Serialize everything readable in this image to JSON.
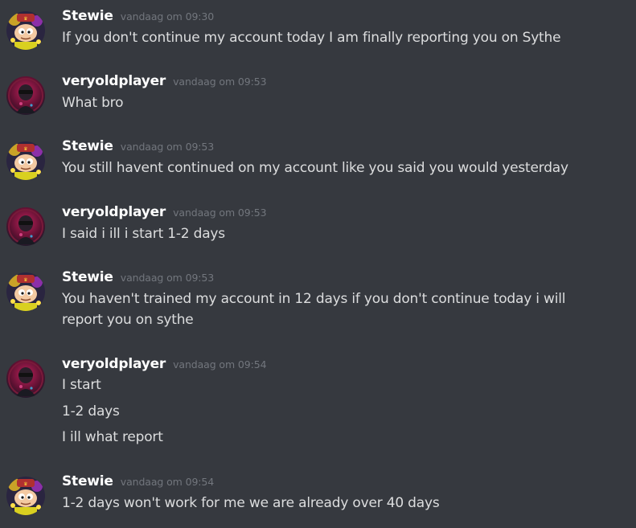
{
  "users": {
    "stewie": {
      "name": "Stewie",
      "avatar_icon": "stewie-avatar-icon"
    },
    "veryoldplayer": {
      "name": "veryoldplayer",
      "avatar_icon": "player-avatar-icon"
    }
  },
  "messages": [
    {
      "author": "Stewie",
      "time": "vandaag om 09:30",
      "lines": [
        "If you don't continue my account today I am finally reporting you on Sythe"
      ]
    },
    {
      "author": "veryoldplayer",
      "time": "vandaag om 09:53",
      "lines": [
        "What bro"
      ]
    },
    {
      "author": "Stewie",
      "time": "vandaag om 09:53",
      "lines": [
        "You still havent continued on my account like you said you would yesterday"
      ]
    },
    {
      "author": "veryoldplayer",
      "time": "vandaag om 09:53",
      "lines": [
        "I said i ill i start 1-2 days"
      ]
    },
    {
      "author": "Stewie",
      "time": "vandaag om 09:53",
      "lines": [
        "You haven't trained my account in 12 days if you don't continue today i will",
        "report you on sythe"
      ]
    },
    {
      "author": "veryoldplayer",
      "time": "vandaag om 09:54",
      "lines": [
        "I start",
        "1-2 days",
        "I ill what report"
      ]
    },
    {
      "author": "Stewie",
      "time": "vandaag om 09:54",
      "lines": [
        "1-2 days won't work for me we are already over 40 days"
      ]
    }
  ],
  "colors": {
    "background": "#36393f",
    "username": "#ffffff",
    "timestamp": "#72767d",
    "message_text": "#dcddde"
  }
}
